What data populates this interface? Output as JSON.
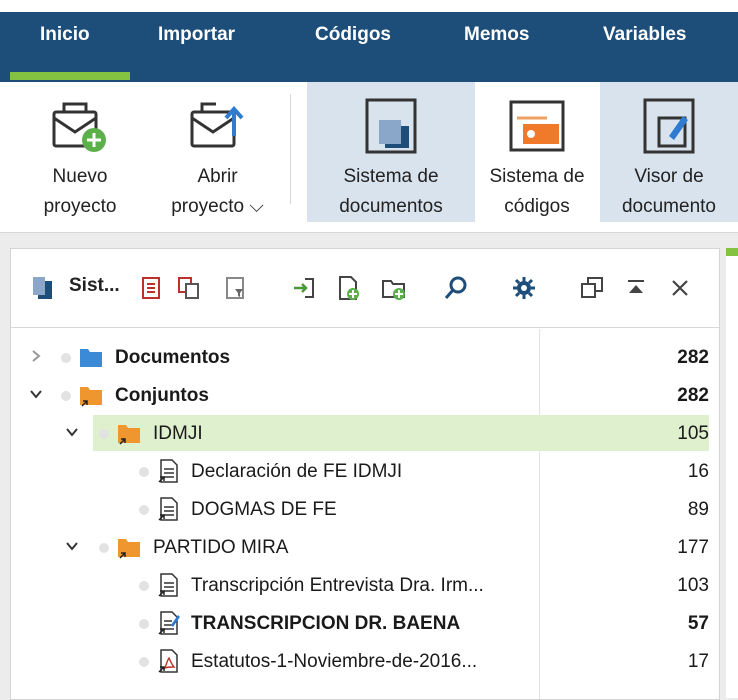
{
  "menubar": {
    "tabs": [
      {
        "label": "Inicio",
        "active": true
      },
      {
        "label": "Importar"
      },
      {
        "label": "Códigos"
      },
      {
        "label": "Memos"
      },
      {
        "label": "Variables"
      }
    ]
  },
  "ribbon": {
    "buttons": [
      {
        "label": "Nuevo\nproyecto",
        "icon": "new-project-icon"
      },
      {
        "label": "Abrir\nproyecto ⌵",
        "icon": "open-project-icon"
      },
      {
        "label": "Sistema de\ndocumentos",
        "icon": "document-system-icon",
        "selected": true
      },
      {
        "label": "Sistema de\ncódigos",
        "icon": "code-system-icon"
      },
      {
        "label": "Visor de\ndocumento",
        "icon": "document-viewer-icon",
        "selected": true
      }
    ]
  },
  "panel": {
    "title": "Sist...",
    "tree": [
      {
        "label": "Documentos",
        "count": "282",
        "bold": true,
        "level": 0,
        "expanded": false,
        "icon": "folder-blue-icon"
      },
      {
        "label": "Conjuntos",
        "count": "282",
        "bold": true,
        "level": 0,
        "expanded": true,
        "icon": "folder-orange-icon"
      },
      {
        "label": "IDMJI",
        "count": "105",
        "bold": false,
        "level": 1,
        "expanded": true,
        "icon": "folder-orange-icon",
        "highlight": true
      },
      {
        "label": "Declaración de FE IDMJI",
        "count": "16",
        "level": 2,
        "icon": "text-document-icon"
      },
      {
        "label": "DOGMAS DE FE",
        "count": "89",
        "level": 2,
        "icon": "text-document-icon"
      },
      {
        "label": "PARTIDO MIRA",
        "count": "177",
        "level": 1,
        "expanded": true,
        "icon": "folder-orange-icon"
      },
      {
        "label": "Transcripción Entrevista Dra. Irm...",
        "count": "103",
        "level": 2,
        "icon": "text-document-icon"
      },
      {
        "label": "TRANSCRIPCION DR. BAENA",
        "count": "57",
        "bold": true,
        "level": 2,
        "icon": "edited-document-icon"
      },
      {
        "label": "Estatutos-1-Noviembre-de-2016...",
        "count": "17",
        "level": 2,
        "icon": "pdf-document-icon"
      }
    ]
  },
  "colors": {
    "menubar": "#1d4e7a",
    "accent": "#84c341",
    "selected": "#d9e3ee",
    "folder_blue": "#3b8ad8",
    "folder_orange": "#f0962e"
  }
}
